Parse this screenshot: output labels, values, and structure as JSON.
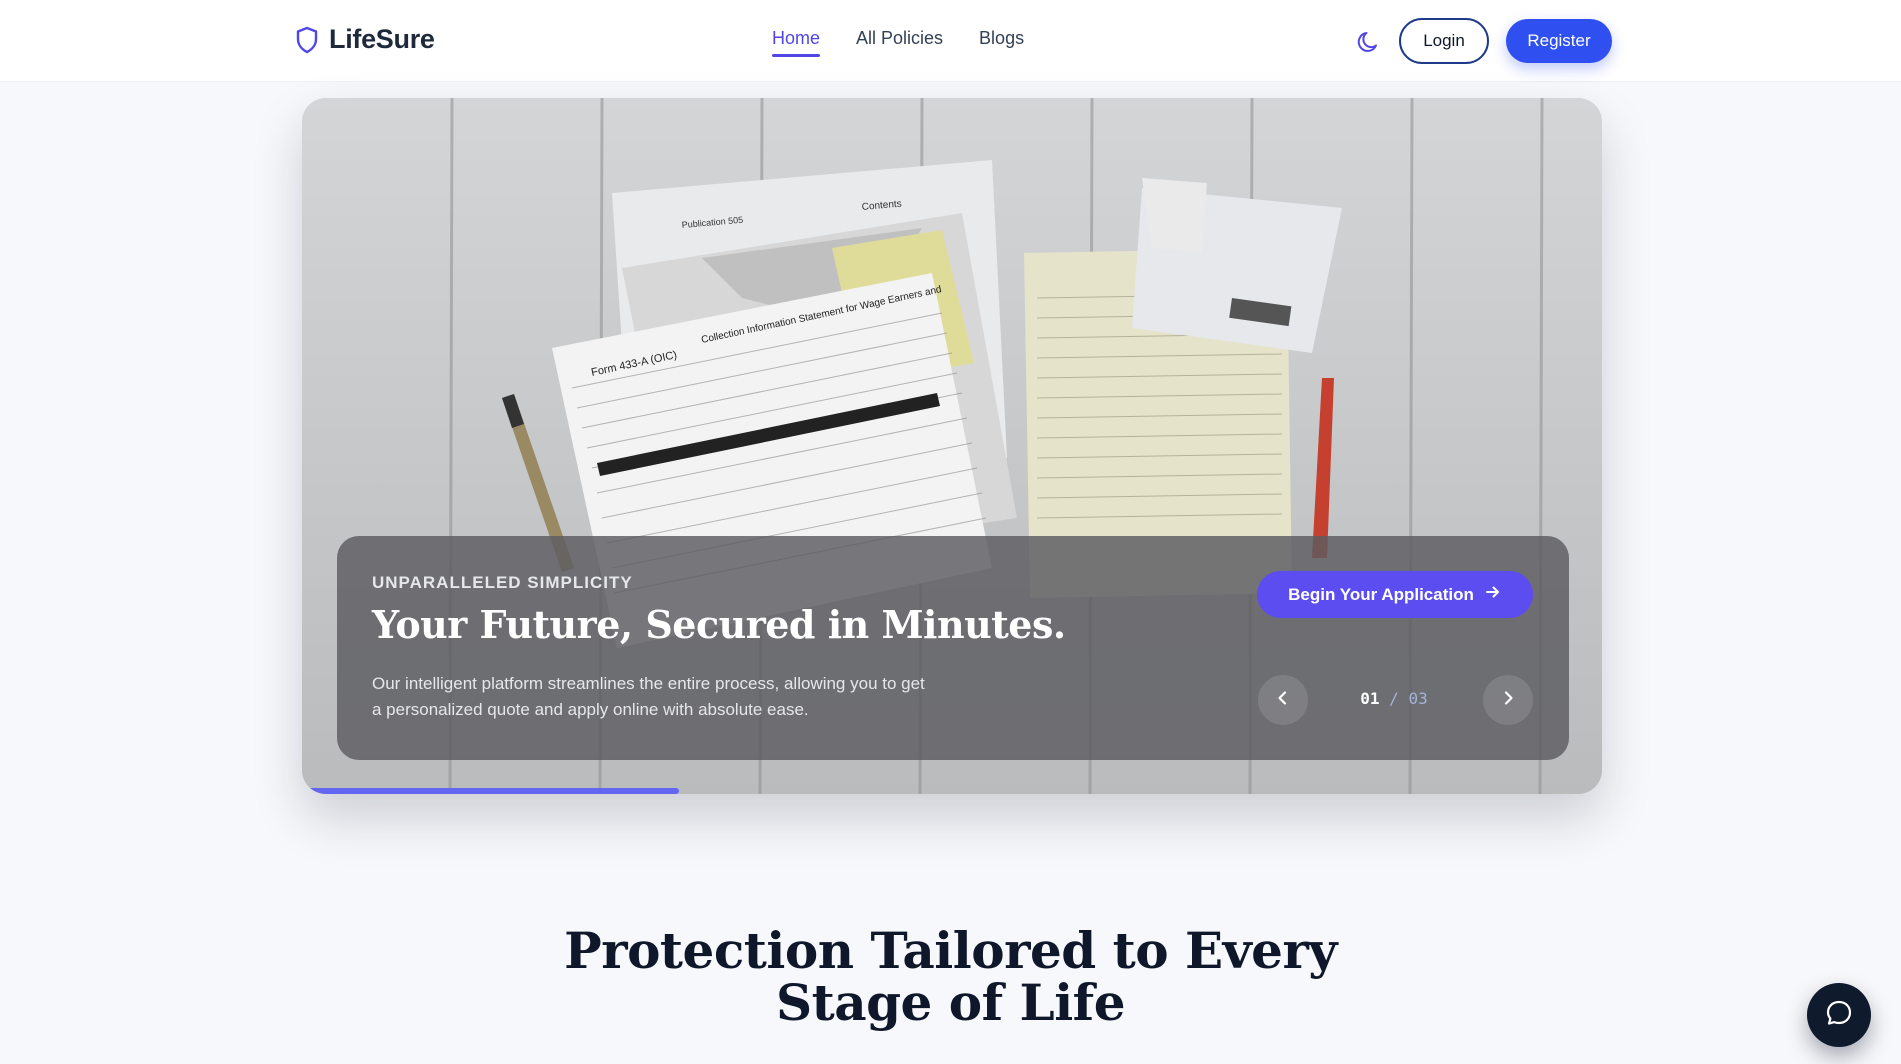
{
  "brand": {
    "name": "LifeSure",
    "icon": "shield-icon"
  },
  "nav": {
    "links": [
      {
        "label": "Home",
        "active": true
      },
      {
        "label": "All Policies",
        "active": false
      },
      {
        "label": "Blogs",
        "active": false
      }
    ],
    "theme_toggle_icon": "moon-icon",
    "login_label": "Login",
    "register_label": "Register"
  },
  "hero": {
    "eyebrow": "UNPARALLELED SIMPLICITY",
    "title": "Your Future, Secured in Minutes.",
    "description": "Our intelligent platform streamlines the process, allowing you to get a personalized quote and apply online with absolute ease.",
    "description_full": "Our intelligent platform streamlines the entire process, allowing you to get a personalized quote and apply online with absolute ease.",
    "cta_label": "Begin Your Application",
    "cta_icon": "arrow-right-icon",
    "slide_current": "01",
    "slide_separator": "/",
    "slide_total": "03",
    "slide_progress": 0.29,
    "prev_icon": "chevron-left-icon",
    "next_icon": "chevron-right-icon"
  },
  "section": {
    "heading_line1": "Protection Tailored to Every",
    "heading_line2": "Stage of Life"
  },
  "chat": {
    "icon": "chat-bubble-icon"
  },
  "colors": {
    "accent": "#4f46e5",
    "register": "#2f4ff0",
    "cta": "#5b4df0",
    "progress": "#6366f1",
    "heading": "#0f172a"
  }
}
